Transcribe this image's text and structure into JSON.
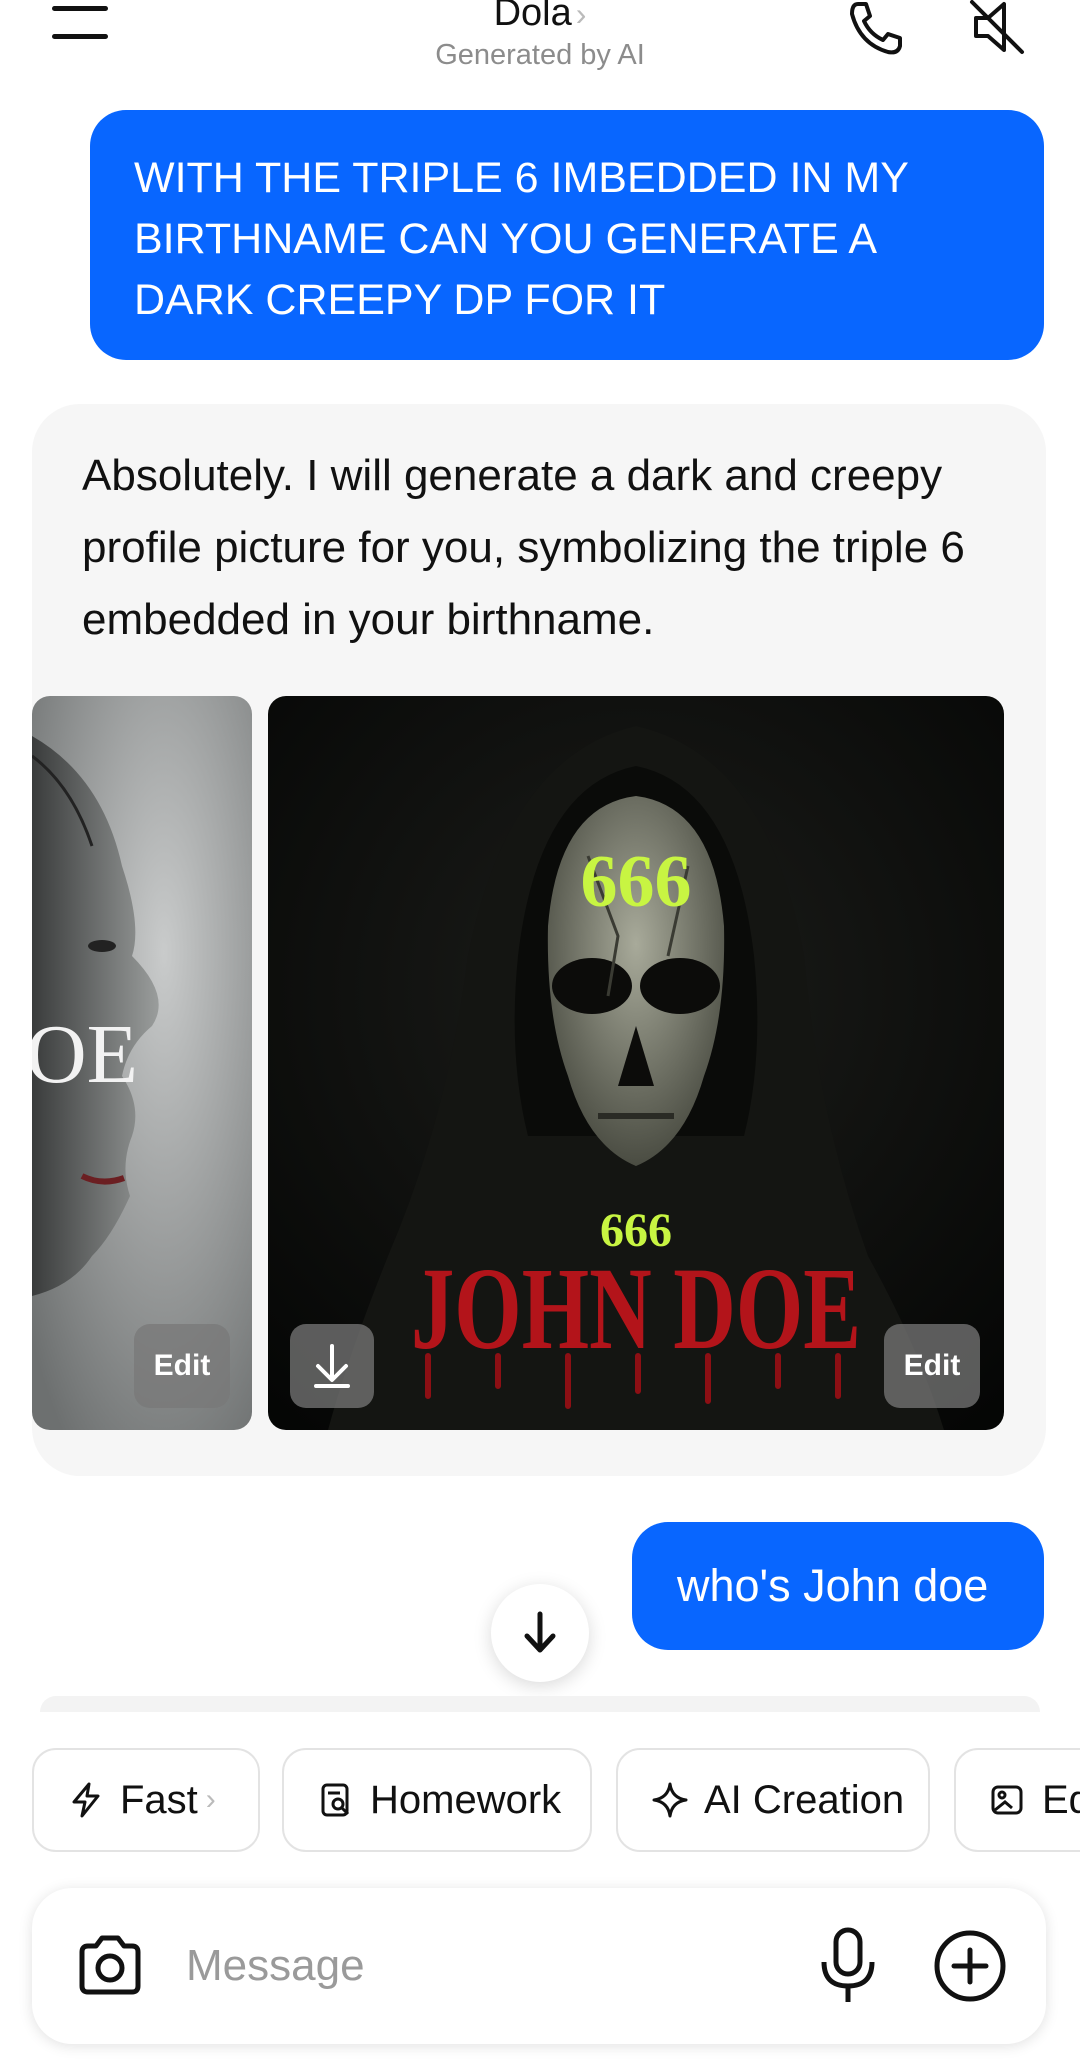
{
  "header": {
    "title": "Dola",
    "title_chevron": "›",
    "subtitle": "Generated by AI"
  },
  "messages": {
    "user_1": "WITH THE TRIPLE 6 IMBEDDED IN MY BIRTHNAME CAN YOU GENERATE A DARK CREEPY DP FOR IT",
    "ai_1": "Absolutely. I will generate a dark and creepy profile picture for you, symbolizing the triple 6 embedded in your birthname.",
    "user_2": "who's John doe"
  },
  "images": {
    "left_partial_text": "OE",
    "main_number_top": "666",
    "main_number_small": "666",
    "main_name": "JOHN DOE",
    "edit_label": "Edit"
  },
  "chips": [
    {
      "label": "Fast",
      "icon": "bolt-icon",
      "chevron": "›"
    },
    {
      "label": "Homework",
      "icon": "homework-icon"
    },
    {
      "label": "AI Creation",
      "icon": "sparkle-icon"
    },
    {
      "label": "Ed",
      "icon": "image-edit-icon"
    }
  ],
  "composer": {
    "placeholder": "Message"
  },
  "colors": {
    "user_bubble": "#0866ff",
    "ai_card": "#f6f6f6",
    "number_green": "#c8f542",
    "name_red": "#b3141a"
  }
}
